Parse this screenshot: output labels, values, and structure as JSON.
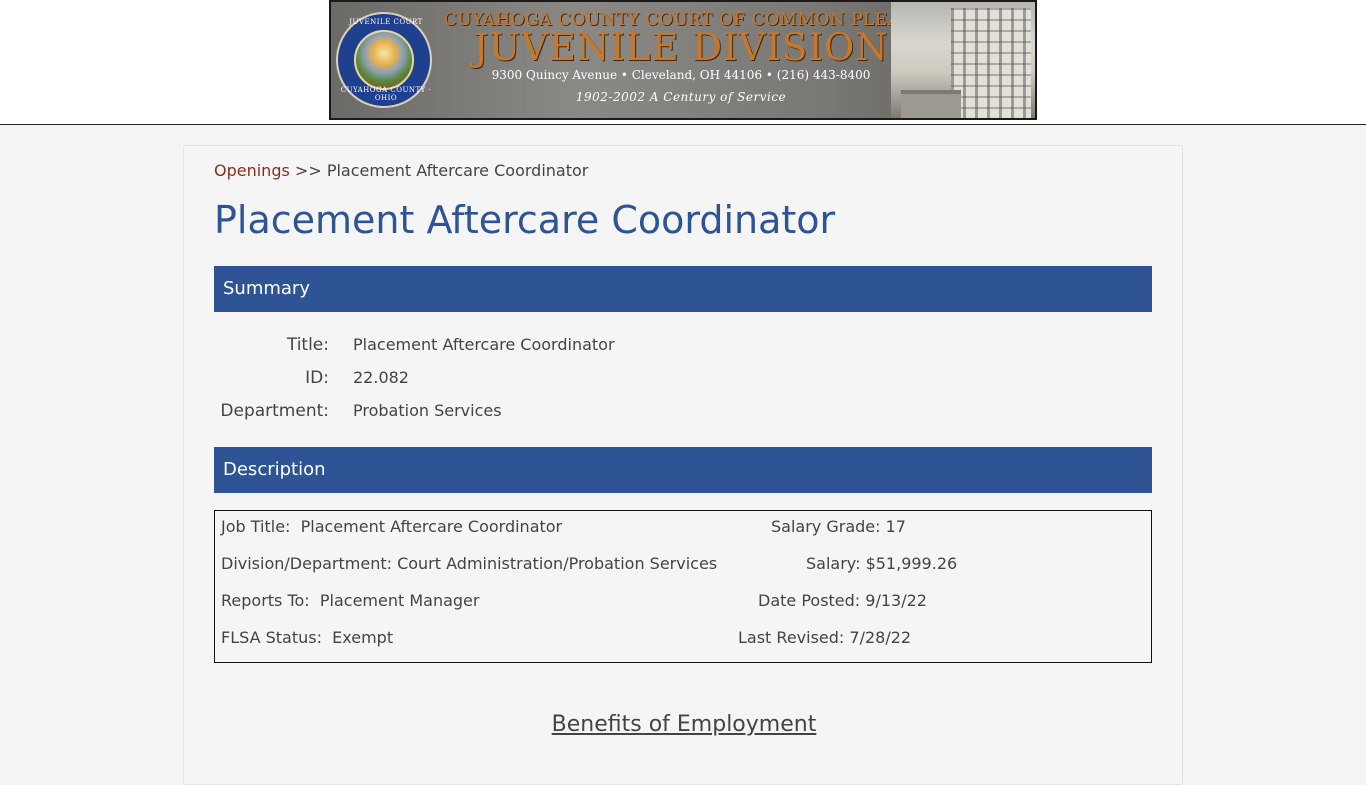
{
  "banner": {
    "line1": "CUYAHOGA COUNTY COURT OF COMMON PLEAS,",
    "line2": "JUVENILE DIVISION",
    "line3": "9300 Quincy Avenue • Cleveland, OH 44106 • (216) 443-8400",
    "line4": "1902-2002 A Century of Service",
    "seal_top": "JUVENILE COURT",
    "seal_bottom": "CUYAHOGA COUNTY · OHIO"
  },
  "breadcrumb": {
    "link": "Openings",
    "separator": ">>",
    "current": "Placement Aftercare Coordinator"
  },
  "page_title": "Placement Aftercare Coordinator",
  "summary": {
    "heading": "Summary",
    "rows": [
      {
        "label": "Title:",
        "value": "Placement Aftercare Coordinator"
      },
      {
        "label": "ID:",
        "value": "22.082"
      },
      {
        "label": "Department:",
        "value": "Probation Services"
      }
    ]
  },
  "description": {
    "heading": "Description",
    "left": [
      "Job Title:  Placement Aftercare Coordinator",
      "Division/Department: Court Administration/Probation Services",
      "Reports To:  Placement Manager",
      "FLSA Status:  Exempt"
    ],
    "right": [
      "Salary Grade: 17",
      "Salary: $51,999.26",
      "Date Posted: 9/13/22",
      "Last Revised: 7/28/22"
    ]
  },
  "benefits_heading": "Benefits of Employment",
  "colors": {
    "accent": "#2e5496",
    "link": "#8b2e1c",
    "background": "#f4f4f4"
  }
}
